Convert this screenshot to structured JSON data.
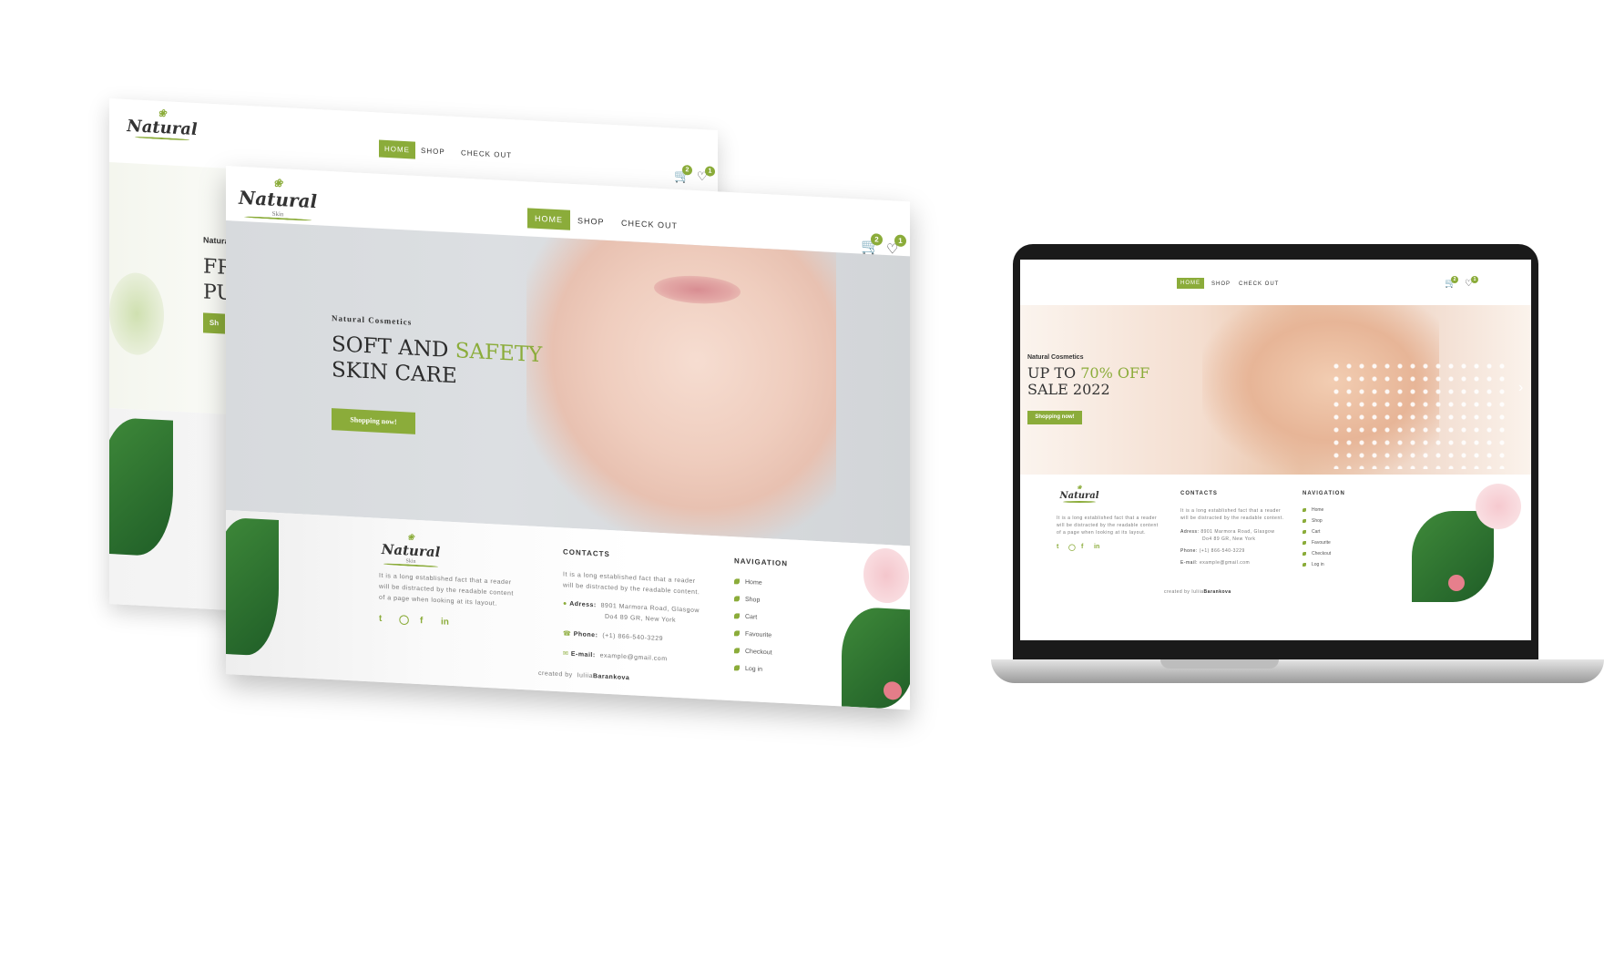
{
  "site": {
    "logo": "Natural",
    "logo_sub": "Skin",
    "nav": [
      "HOME",
      "SHOP",
      "CHECK OUT"
    ],
    "cart_count": "2",
    "fav_count": "1",
    "cart_icon": "cart-icon",
    "heart_icon": "heart-icon"
  },
  "back_mock": {
    "eyebrow": "Natural",
    "headline_1": "FR",
    "headline_2": "PU",
    "button": "Sh"
  },
  "front_mock": {
    "eyebrow": "Natural Cosmetics",
    "headline_1a": "SOFT AND ",
    "headline_1b": "SAFETY",
    "headline_2": "SKIN  CARE",
    "button": "Shopping now!"
  },
  "laptop_mock": {
    "eyebrow": "Natural Cosmetics",
    "headline_1a": "UP TO ",
    "headline_1b": "70% OFF",
    "headline_2": "SALE  2022",
    "button": "Shopping now!",
    "arrow": "›"
  },
  "footer": {
    "about": [
      "It is a long established fact that a reader",
      "will be distracted by the readable content",
      "of a page when looking at its layout."
    ],
    "contacts_title": "CONTACTS",
    "contacts_text": [
      "It is a long established fact that a reader",
      "will be distracted by the readable content."
    ],
    "address_label": "Adress:",
    "address": [
      "8901 Marmora Road, Glasgow",
      "Do4 89 GR, New York"
    ],
    "phone_label": "Phone:",
    "phone": "(+1) 866-540-3229",
    "email_label": "E-mail:",
    "email": "example@gmail.com",
    "navigation_title": "NAVIGATION",
    "navigation": [
      "Home",
      "Shop",
      "Cart",
      "Favourite",
      "Checkout",
      "Log in"
    ],
    "social": [
      "twitter-icon",
      "instagram-icon",
      "facebook-icon",
      "linkedin-icon"
    ],
    "credit_prefix": "created by",
    "credit_first": "Iuliia",
    "credit_last": "Barankova"
  },
  "colors": {
    "accent": "#8bac3a",
    "text": "#333333"
  }
}
